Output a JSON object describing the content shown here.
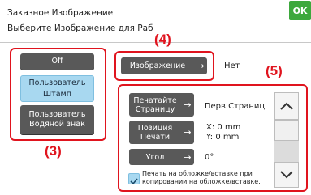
{
  "header": {
    "title_line1": "Заказное Изображение",
    "title_line2": "Выберите Изображение для Раб",
    "ok_label": "OK"
  },
  "callouts": {
    "c3": "(3)",
    "c4": "(4)",
    "c5": "(5)"
  },
  "left_panel": {
    "off_label": "Off",
    "user_stamp_label": "Пользователь\nШтамп",
    "user_watermark_label": "Пользователь\nВодяной знак"
  },
  "image_row": {
    "button_label": "Изображение",
    "value": "Нет"
  },
  "settings": {
    "print_page_label": "Печатайте\nСтраницу",
    "print_page_value": "Перв Страниц",
    "print_position_label": "Позиция\nПечати",
    "print_position_x": "X: 0 mm",
    "print_position_y": "Y: 0 mm",
    "angle_label": "Угол",
    "angle_value": "0°",
    "cover_checkbox_label_line1": "Печать на обложке/вставке при",
    "cover_checkbox_label_line2": "копировании на обложке/вставке.",
    "cover_checkbox_checked": true
  },
  "colors": {
    "accent_red": "#e0141e",
    "ok_green": "#3da83d",
    "button_dark": "#595959",
    "selected_blue": "#a8d8f0"
  }
}
